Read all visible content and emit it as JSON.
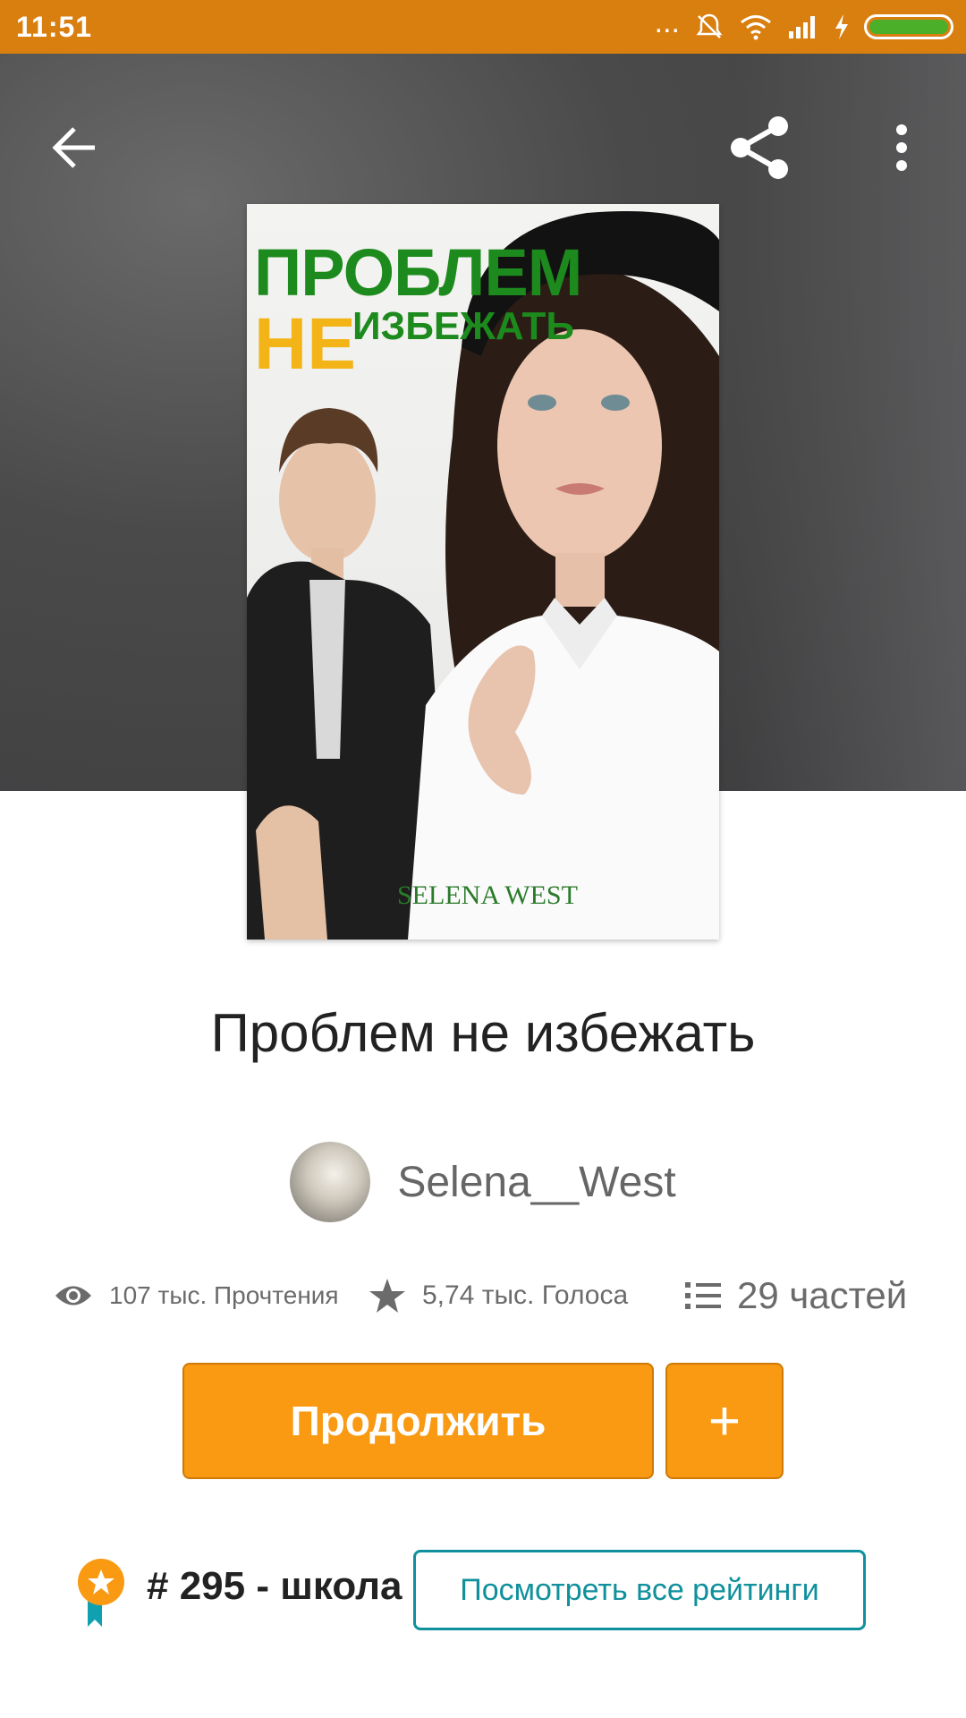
{
  "status_bar": {
    "time": "11:51",
    "dots": "...",
    "icons": [
      "silent-icon",
      "wifi-icon",
      "signal-icon",
      "charging-icon",
      "battery-icon"
    ]
  },
  "header": {
    "icons": [
      "back-arrow-icon",
      "share-icon",
      "more-vert-icon"
    ]
  },
  "cover": {
    "title_line1": "ПРОБЛЕМ",
    "title_line2_big": "НЕ",
    "title_line2_small": "ИЗБЕЖАТЬ",
    "author": "SELENA WEST"
  },
  "book": {
    "title": "Проблем не избежать",
    "author": "Selena__West"
  },
  "stats": {
    "reads": "107 тыс. Прочтения",
    "votes": "5,74 тыс. Голоса",
    "parts": "29 частей"
  },
  "actions": {
    "continue_label": "Продолжить",
    "add_label": "+"
  },
  "ranking": {
    "text": "# 295 - школа",
    "button_label": "Посмотреть все рейтинги"
  },
  "colors": {
    "status_bar": "#d97f10",
    "primary_orange": "#f99a12",
    "teal": "#10909c",
    "battery_green": "#4caf2a"
  }
}
